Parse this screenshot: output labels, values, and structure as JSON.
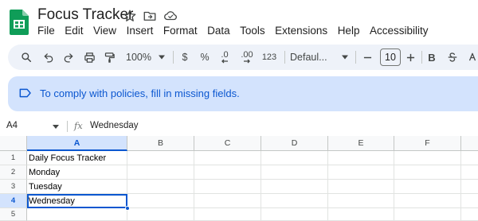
{
  "app": {
    "title": "Focus Tracker"
  },
  "menu": [
    "File",
    "Edit",
    "View",
    "Insert",
    "Format",
    "Data",
    "Tools",
    "Extensions",
    "Help",
    "Accessibility"
  ],
  "toolbar": {
    "zoom": "100%",
    "currency": "$",
    "percent": "%",
    "decrease_decimal": ".0",
    "increase_decimal": ".00",
    "number_format": "123",
    "font": "Defaul...",
    "font_size": "10",
    "bold": "B"
  },
  "banner": {
    "text": "To comply with policies, fill in missing fields."
  },
  "formula_bar": {
    "cell_ref": "A4",
    "fx": "fx",
    "value": "Wednesday"
  },
  "grid": {
    "columns": [
      "A",
      "B",
      "C",
      "D",
      "E",
      "F"
    ],
    "selected_column": "A",
    "rows": [
      {
        "num": "1",
        "a": "Daily Focus Tracker"
      },
      {
        "num": "2",
        "a": "Monday"
      },
      {
        "num": "3",
        "a": "Tuesday"
      },
      {
        "num": "4",
        "a": "Wednesday"
      },
      {
        "num": "5",
        "a": ""
      }
    ],
    "selected_row": "4"
  },
  "colors": {
    "accent": "#0b57d0",
    "banner_bg": "#d3e3fd",
    "toolbar_bg": "#eef2f9",
    "sheets_green": "#0f9d58"
  }
}
